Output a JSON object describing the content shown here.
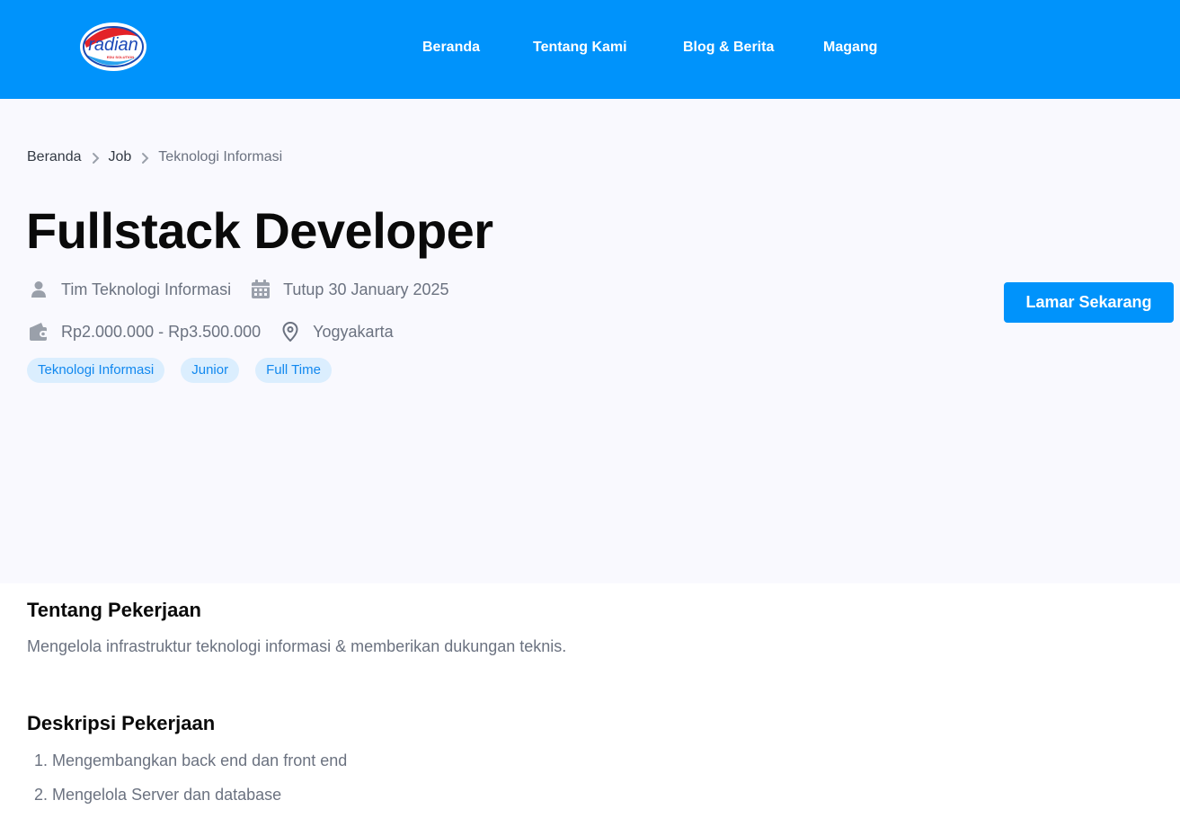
{
  "header": {
    "logo_text": "radian",
    "logo_subtext": "EDU SOLUTION",
    "nav": [
      "Beranda",
      "Tentang Kami",
      "Blog & Berita",
      "Magang"
    ]
  },
  "breadcrumb": [
    "Beranda",
    "Job",
    "Teknologi Informasi"
  ],
  "job": {
    "title": "Fullstack Developer",
    "team": "Tim Teknologi Informasi",
    "deadline": "Tutup 30 January 2025",
    "salary": "Rp2.000.000 - Rp3.500.000",
    "location": "Yogyakarta",
    "tags": [
      "Teknologi Informasi",
      "Junior",
      "Full Time"
    ],
    "apply_label": "Lamar Sekarang"
  },
  "about": {
    "heading": "Tentang Pekerjaan",
    "text": "Mengelola infrastruktur teknologi informasi & memberikan dukungan teknis."
  },
  "description": {
    "heading": "Deskripsi Pekerjaan",
    "items": [
      "1. Mengembangkan back end dan front end",
      "2. Mengelola Server dan database"
    ]
  },
  "icons": {
    "team": "user-icon",
    "deadline": "calendar-icon",
    "salary": "wallet-icon",
    "location": "location-pin-icon",
    "breadcrumb_separator": "chevron-right-icon"
  },
  "colors": {
    "brand": "#0093fb",
    "hero_bg": "#f9f9fe",
    "tag_bg": "#dbeefe",
    "tag_text": "#1188ef",
    "muted_text": "#6b7280"
  }
}
